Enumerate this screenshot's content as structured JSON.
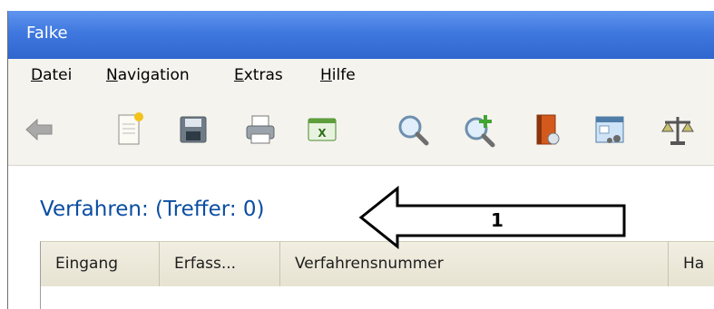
{
  "window": {
    "title": "Falke"
  },
  "menu": [
    {
      "underline": "D",
      "rest": "atei"
    },
    {
      "underline": "N",
      "rest": "avigation"
    },
    {
      "underline": "E",
      "rest": "xtras"
    },
    {
      "underline": "H",
      "rest": "ilfe"
    }
  ],
  "toolbar": {
    "icons": [
      "back-arrow-icon",
      "new-document-icon",
      "save-icon",
      "print-icon",
      "excel-export-icon",
      "search-icon",
      "add-search-icon",
      "address-book-icon",
      "window-layout-icon",
      "scales-icon"
    ]
  },
  "main": {
    "title": "Verfahren: (Treffer: 0)",
    "columns": [
      "Eingang",
      "Erfass...",
      "Verfahrensnummer",
      "Ha"
    ]
  },
  "annotation": {
    "label": "1"
  }
}
